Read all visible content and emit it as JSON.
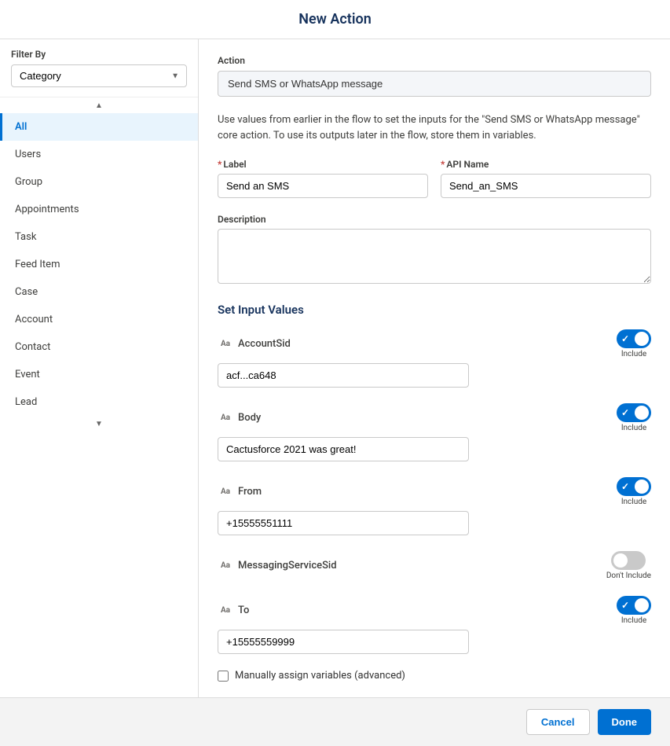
{
  "modal": {
    "title": "New Action"
  },
  "sidebar": {
    "filter_label": "Filter By",
    "filter_value": "Category",
    "items": [
      {
        "id": "all",
        "label": "All",
        "active": true
      },
      {
        "id": "users",
        "label": "Users",
        "active": false
      },
      {
        "id": "group",
        "label": "Group",
        "active": false
      },
      {
        "id": "appointments",
        "label": "Appointments",
        "active": false
      },
      {
        "id": "task",
        "label": "Task",
        "active": false
      },
      {
        "id": "feed-item",
        "label": "Feed Item",
        "active": false
      },
      {
        "id": "case",
        "label": "Case",
        "active": false
      },
      {
        "id": "account",
        "label": "Account",
        "active": false
      },
      {
        "id": "contact",
        "label": "Contact",
        "active": false
      },
      {
        "id": "event",
        "label": "Event",
        "active": false
      },
      {
        "id": "lead",
        "label": "Lead",
        "active": false
      }
    ]
  },
  "main": {
    "action_label": "Action",
    "action_value": "Send SMS or WhatsApp message",
    "info_text": "Use values from earlier in the flow to set the inputs for the \"Send SMS or WhatsApp message\" core action. To use its outputs later in the flow, store them in variables.",
    "label_field": {
      "label": "Label",
      "required": true,
      "value": "Send an SMS"
    },
    "api_name_field": {
      "label": "API Name",
      "required": true,
      "value": "Send_an_SMS"
    },
    "description_field": {
      "label": "Description",
      "value": ""
    },
    "set_input_values_title": "Set Input Values",
    "fields": [
      {
        "id": "account-sid",
        "name": "AccountSid",
        "value": "acf...ca648",
        "toggle": true,
        "toggle_label": "Include"
      },
      {
        "id": "body",
        "name": "Body",
        "value": "Cactusforce 2021 was great!",
        "toggle": true,
        "toggle_label": "Include"
      },
      {
        "id": "from",
        "name": "From",
        "value": "+15555551111",
        "toggle": true,
        "toggle_label": "Include"
      },
      {
        "id": "messaging-service-sid",
        "name": "MessagingServiceSid",
        "value": "",
        "toggle": false,
        "toggle_label": "Don't Include"
      },
      {
        "id": "to",
        "name": "To",
        "value": "+15555559999",
        "toggle": true,
        "toggle_label": "Include"
      }
    ],
    "advanced_checkbox_label": "Manually assign variables (advanced)"
  },
  "footer": {
    "cancel_label": "Cancel",
    "done_label": "Done"
  }
}
